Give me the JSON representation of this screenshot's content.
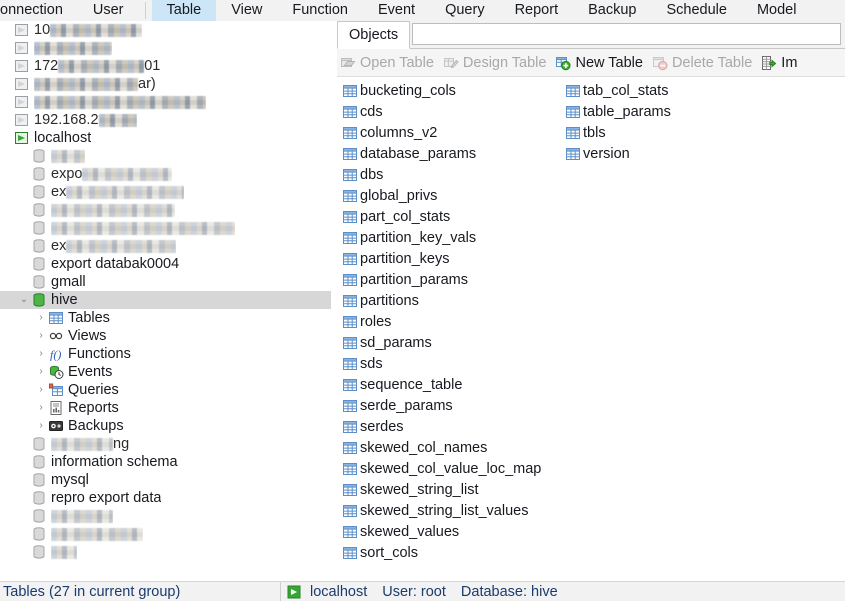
{
  "menubar": {
    "items": [
      {
        "label": "onnection",
        "active": false,
        "clipped": true
      },
      {
        "label": "User",
        "active": false
      },
      {
        "label": "Table",
        "active": true
      },
      {
        "label": "View",
        "active": false
      },
      {
        "label": "Function",
        "active": false
      },
      {
        "label": "Event",
        "active": false
      },
      {
        "label": "Query",
        "active": false
      },
      {
        "label": "Report",
        "active": false
      },
      {
        "label": "Backup",
        "active": false
      },
      {
        "label": "Schedule",
        "active": false
      },
      {
        "label": "Model",
        "active": false
      }
    ]
  },
  "sidebar": {
    "rows": [
      {
        "icon": "connection-icon",
        "label": "10",
        "indent": 0,
        "redacted": true,
        "redact_width": 92,
        "prefix": "10"
      },
      {
        "icon": "connection-icon",
        "label": "",
        "indent": 0,
        "redacted": true,
        "redact_width": 78,
        "prefix": ""
      },
      {
        "icon": "connection-icon",
        "label": "172",
        "indent": 0,
        "redacted": true,
        "redact_width": 86,
        "prefix": "172",
        "suffix": "01"
      },
      {
        "icon": "connection-icon",
        "label": "",
        "indent": 0,
        "redacted": true,
        "redact_width": 104,
        "prefix": "",
        "suffix": "ar)"
      },
      {
        "icon": "connection-icon",
        "label": "",
        "indent": 0,
        "redacted": true,
        "redact_width": 172,
        "prefix": ""
      },
      {
        "icon": "connection-icon",
        "label": "192.168.2",
        "indent": 0,
        "redacted": true,
        "redact_width": 38,
        "prefix": "192.168.2"
      },
      {
        "icon": "connection-green-icon",
        "label": "localhost",
        "indent": 0,
        "redacted": false
      },
      {
        "icon": "database-icon",
        "label": "",
        "indent": 1,
        "redacted": true,
        "redact_width": 34
      },
      {
        "icon": "database-icon",
        "label": "",
        "indent": 1,
        "redacted": true,
        "redact_width": 90,
        "prefix": "expo"
      },
      {
        "icon": "database-icon",
        "label": "",
        "indent": 1,
        "redacted": true,
        "redact_width": 118,
        "prefix": "ex"
      },
      {
        "icon": "database-icon",
        "label": "",
        "indent": 1,
        "redacted": true,
        "redact_width": 124,
        "prefix": ""
      },
      {
        "icon": "database-icon",
        "label": "",
        "indent": 1,
        "redacted": true,
        "redact_width": 184,
        "prefix": ""
      },
      {
        "icon": "database-icon",
        "label": "",
        "indent": 1,
        "redacted": true,
        "redact_width": 110,
        "prefix": "ex"
      },
      {
        "icon": "database-icon",
        "label": "export databak0004",
        "indent": 1,
        "redacted": false
      },
      {
        "icon": "database-icon",
        "label": "gmall",
        "indent": 1,
        "redacted": false
      },
      {
        "icon": "database-open-icon",
        "label": "hive",
        "indent": 1,
        "redacted": false,
        "selected": true,
        "expanded": true
      },
      {
        "icon": "tables-icon",
        "label": "Tables",
        "indent": 2,
        "redacted": false,
        "collapsible": true
      },
      {
        "icon": "views-icon",
        "label": "Views",
        "indent": 2,
        "redacted": false,
        "collapsible": true
      },
      {
        "icon": "functions-icon",
        "label": "Functions",
        "indent": 2,
        "redacted": false,
        "collapsible": true
      },
      {
        "icon": "events-icon",
        "label": "Events",
        "indent": 2,
        "redacted": false,
        "collapsible": true
      },
      {
        "icon": "queries-icon",
        "label": "Queries",
        "indent": 2,
        "redacted": false,
        "collapsible": true
      },
      {
        "icon": "reports-icon",
        "label": "Reports",
        "indent": 2,
        "redacted": false,
        "collapsible": true
      },
      {
        "icon": "backups-icon",
        "label": "Backups",
        "indent": 2,
        "redacted": false,
        "collapsible": true
      },
      {
        "icon": "database-icon",
        "label": "",
        "indent": 1,
        "redacted": true,
        "redact_width": 62,
        "suffix": "ng"
      },
      {
        "icon": "database-icon",
        "label": "information schema",
        "indent": 1,
        "redacted": false
      },
      {
        "icon": "database-icon",
        "label": "mysql",
        "indent": 1,
        "redacted": false
      },
      {
        "icon": "database-icon",
        "label": "repro export data",
        "indent": 1,
        "redacted": false
      },
      {
        "icon": "database-icon",
        "label": "",
        "indent": 1,
        "redacted": true,
        "redact_width": 62
      },
      {
        "icon": "database-icon",
        "label": "",
        "indent": 1,
        "redacted": true,
        "redact_width": 92
      },
      {
        "icon": "database-icon",
        "label": "",
        "indent": 1,
        "redacted": true,
        "redact_width": 26
      }
    ]
  },
  "main": {
    "objects_tab": "Objects",
    "filter_value": "",
    "toolbar": [
      {
        "label": "Open Table",
        "icon": "open-table-icon",
        "enabled": false
      },
      {
        "label": "Design Table",
        "icon": "design-table-icon",
        "enabled": false
      },
      {
        "label": "New Table",
        "icon": "new-table-icon",
        "enabled": true
      },
      {
        "label": "Delete Table",
        "icon": "delete-table-icon",
        "enabled": false
      },
      {
        "label": "Im",
        "icon": "import-wizard-icon",
        "enabled": true
      }
    ],
    "tables_column1": [
      "bucketing_cols",
      "cds",
      "columns_v2",
      "database_params",
      "dbs",
      "global_privs",
      "part_col_stats",
      "partition_key_vals",
      "partition_keys",
      "partition_params",
      "partitions",
      "roles",
      "sd_params",
      "sds",
      "sequence_table",
      "serde_params",
      "serdes",
      "skewed_col_names",
      "skewed_col_value_loc_map",
      "skewed_string_list",
      "skewed_string_list_values",
      "skewed_values",
      "sort_cols"
    ],
    "tables_column2": [
      "tab_col_stats",
      "table_params",
      "tbls",
      "version"
    ]
  },
  "statusbar": {
    "left": "Tables (27 in current group)",
    "host": "localhost",
    "user": "User: root",
    "database": "Database: hive"
  },
  "colors": {
    "accent": "#cce6f7",
    "selection": "#d7d7d7",
    "table_icon_blue": "#5b8fc9",
    "db_green": "#36a935",
    "status_text": "#1a3b6e",
    "disabled_text": "#a8a8a8"
  }
}
